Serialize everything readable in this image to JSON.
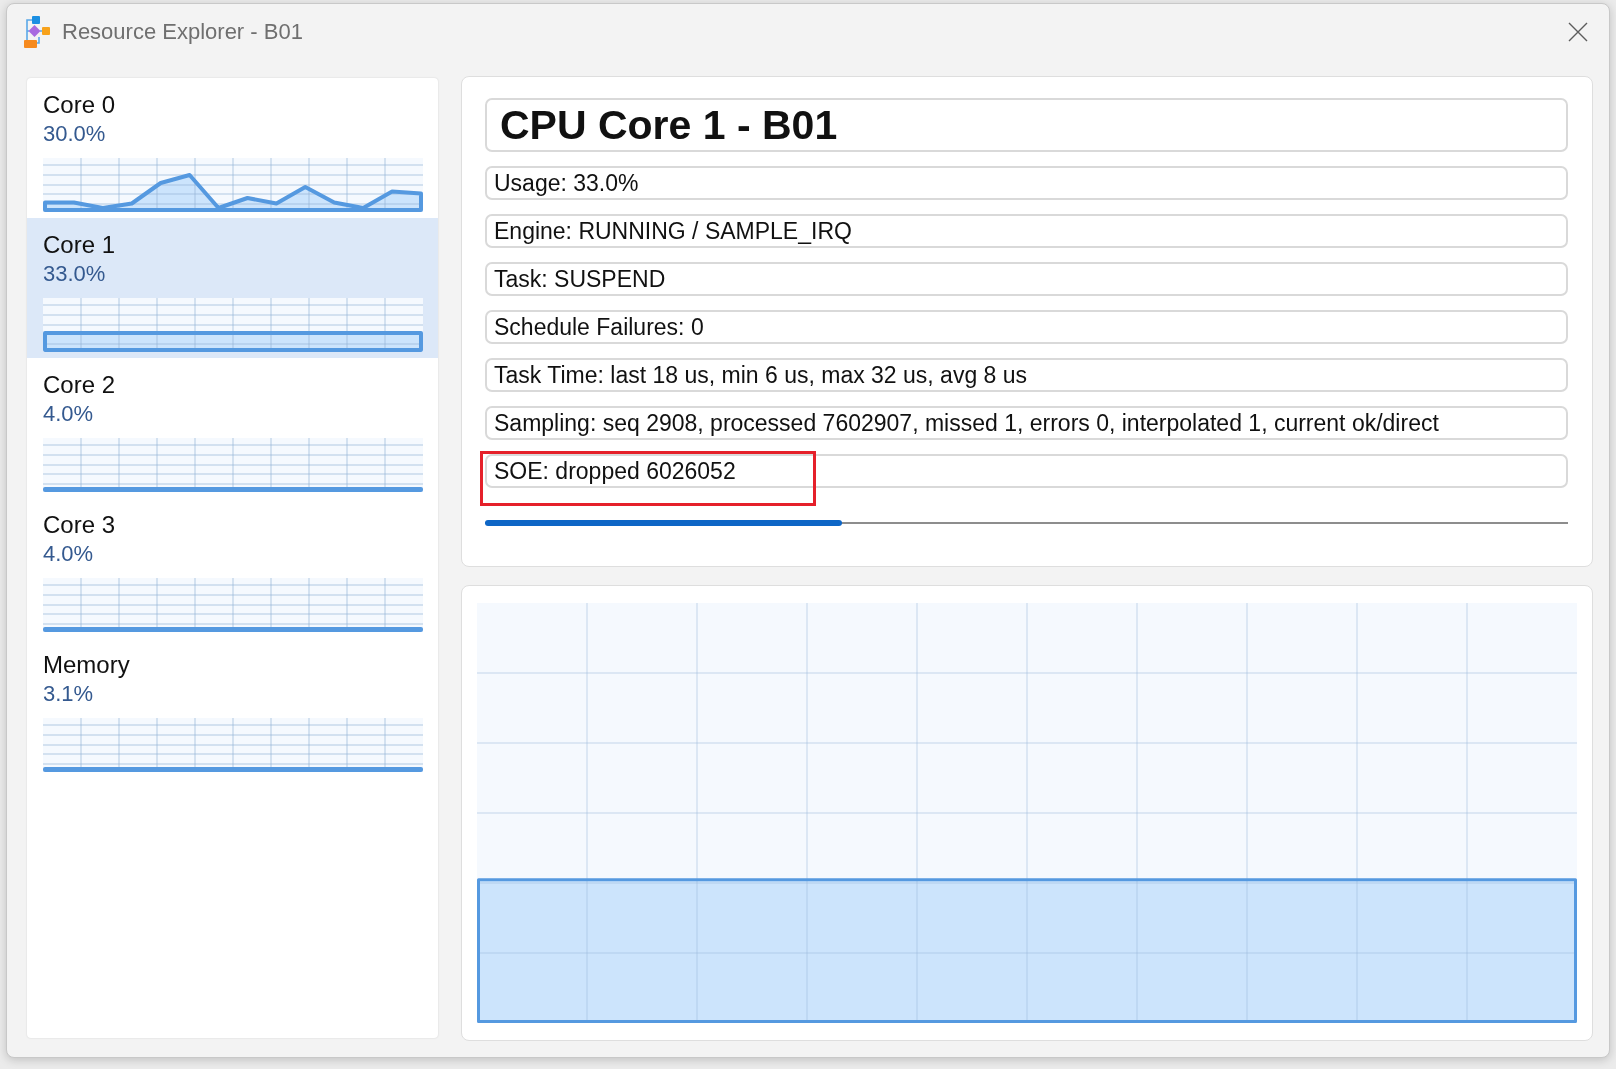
{
  "window": {
    "title": "Resource Explorer - B01"
  },
  "sidebar": {
    "items": [
      {
        "name": "Core 0",
        "value": "30.0%",
        "selected": false
      },
      {
        "name": "Core 1",
        "value": "33.0%",
        "selected": true
      },
      {
        "name": "Core 2",
        "value": "4.0%",
        "selected": false
      },
      {
        "name": "Core 3",
        "value": "4.0%",
        "selected": false
      },
      {
        "name": "Memory",
        "value": "3.1%",
        "selected": false
      }
    ]
  },
  "details": {
    "title": "CPU Core 1 - B01",
    "fields": [
      {
        "text": "Usage: 33.0%",
        "highlighted": false
      },
      {
        "text": "Engine: RUNNING / SAMPLE_IRQ",
        "highlighted": false
      },
      {
        "text": "Task: SUSPEND",
        "highlighted": false
      },
      {
        "text": "Schedule Failures: 0",
        "highlighted": false
      },
      {
        "text": "Task Time: last 18 us, min 6 us, max 32 us, avg 8 us",
        "highlighted": false
      },
      {
        "text": "Sampling: seq 2908, processed 7602907, missed 1, errors 0, interpolated 1, current ok/direct",
        "highlighted": false
      },
      {
        "text": "SOE: dropped 6026052",
        "highlighted": true
      }
    ],
    "progress": {
      "level": 0.33
    }
  }
}
